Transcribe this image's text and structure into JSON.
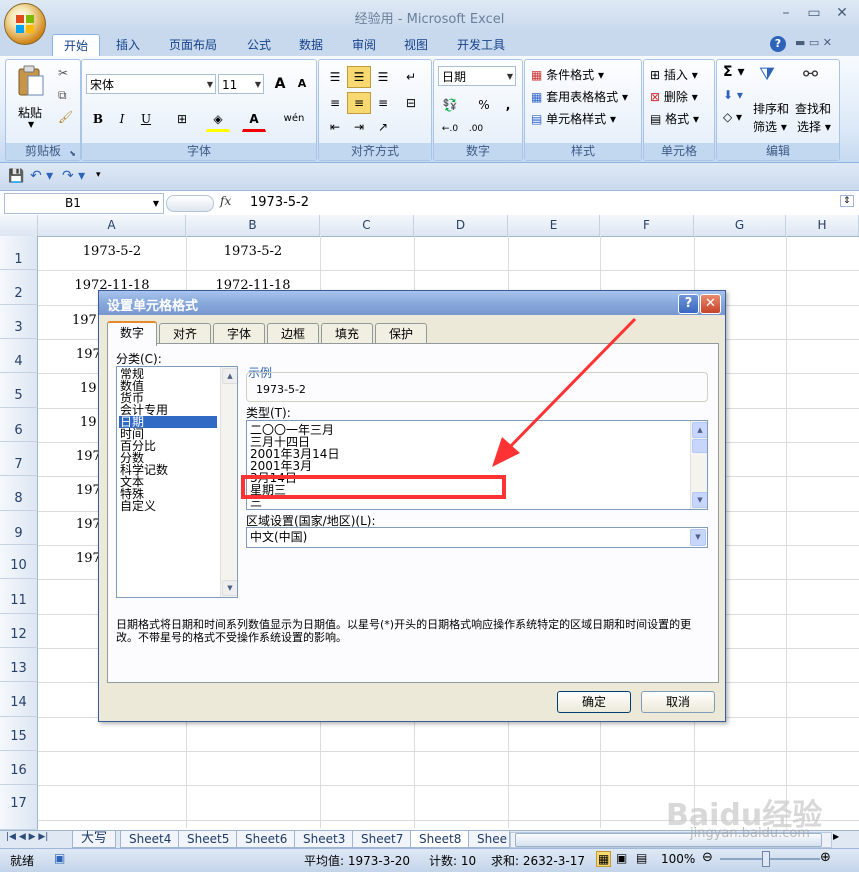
{
  "window": {
    "title": "经验用 - Microsoft Excel",
    "minimize": "–",
    "restore": "▭",
    "close": "✕"
  },
  "ribbon": {
    "tabs": [
      "开始",
      "插入",
      "页面布局",
      "公式",
      "数据",
      "审阅",
      "视图",
      "开发工具"
    ],
    "active_tab": "开始",
    "help": "?",
    "clipboard": {
      "paste": "粘贴",
      "label": "剪贴板"
    },
    "font": {
      "name": "宋体",
      "size": "11",
      "grow": "A",
      "shrink": "A",
      "bold": "B",
      "italic": "I",
      "underline": "U",
      "phonetic": "wén",
      "label": "字体"
    },
    "alignment": {
      "label": "对齐方式"
    },
    "number": {
      "format": "日期",
      "percent": "%",
      "comma": ",",
      "inc": "←.0",
      "dec": ".00",
      "label": "数字"
    },
    "styles": {
      "conditional": "条件格式",
      "table": "套用表格格式",
      "cell": "单元格样式",
      "label": "样式"
    },
    "cells": {
      "insert": "插入",
      "delete": "删除",
      "format": "格式",
      "label": "单元格"
    },
    "editing": {
      "sum": "Σ",
      "sort": "排序和",
      "sort2": "筛选",
      "find": "查找和",
      "find2": "选择",
      "label": "编辑"
    }
  },
  "formula_bar": {
    "name_box": "B1",
    "fx": "fx",
    "content": "1973-5-2"
  },
  "sheet": {
    "columns": [
      "A",
      "B",
      "C",
      "D",
      "E",
      "F",
      "G",
      "H"
    ],
    "rows": [
      "1",
      "2",
      "3",
      "4",
      "5",
      "6",
      "7",
      "8",
      "9",
      "10",
      "11",
      "12",
      "13",
      "14",
      "15",
      "16",
      "17"
    ],
    "cells": {
      "A1": "1973-5-2",
      "B1": "1973-5-2",
      "A2": "1972-11-18",
      "B2": "1972-11-18",
      "A3": "197",
      "A4": "197",
      "A5": "19",
      "A6": "19",
      "A7": "197",
      "A8": "197",
      "A9": "197",
      "A10": "197"
    }
  },
  "sheet_tabs": [
    "大写",
    "Sheet4",
    "Sheet5",
    "Sheet6",
    "Sheet3",
    "Sheet7",
    "Sheet8",
    "Shee"
  ],
  "active_sheet": "Sheet8",
  "status": {
    "mode": "就绪",
    "average": "平均值: 1973-3-20",
    "count": "计数: 10",
    "sum": "求和: 2632-3-17",
    "zoom": "100%"
  },
  "dialog": {
    "title": "设置单元格格式",
    "help": "?",
    "close": "✕",
    "tabs": [
      "数字",
      "对齐",
      "字体",
      "边框",
      "填充",
      "保护"
    ],
    "active_tab": "数字",
    "category_label": "分类(C):",
    "categories": [
      "常规",
      "数值",
      "货币",
      "会计专用",
      "日期",
      "时间",
      "百分比",
      "分数",
      "科学记数",
      "文本",
      "特殊",
      "自定义"
    ],
    "selected_category": "日期",
    "sample_label": "示例",
    "sample_value": "1973-5-2",
    "type_label": "类型(T):",
    "types": [
      "二〇〇一年三月",
      "三月十四日",
      "2001年3月14日",
      "2001年3月",
      "3月14日",
      "星期三",
      "三"
    ],
    "highlighted_type": "星期三",
    "locale_label": "区域设置(国家/地区)(L):",
    "locale_value": "中文(中国)",
    "description": "日期格式将日期和时间系列数值显示为日期值。以星号(*)开头的日期格式响应操作系统特定的区域日期和时间设置的更改。不带星号的格式不受操作系统设置的影响。",
    "ok": "确定",
    "cancel": "取消"
  },
  "watermark": {
    "brand": "Baidu经验",
    "url": "jingyan.baidu.com"
  },
  "colors": {
    "accent_blue": "#316ac5",
    "annotation_red": "#ff3333",
    "ribbon_bg": "#dbe8f7"
  }
}
